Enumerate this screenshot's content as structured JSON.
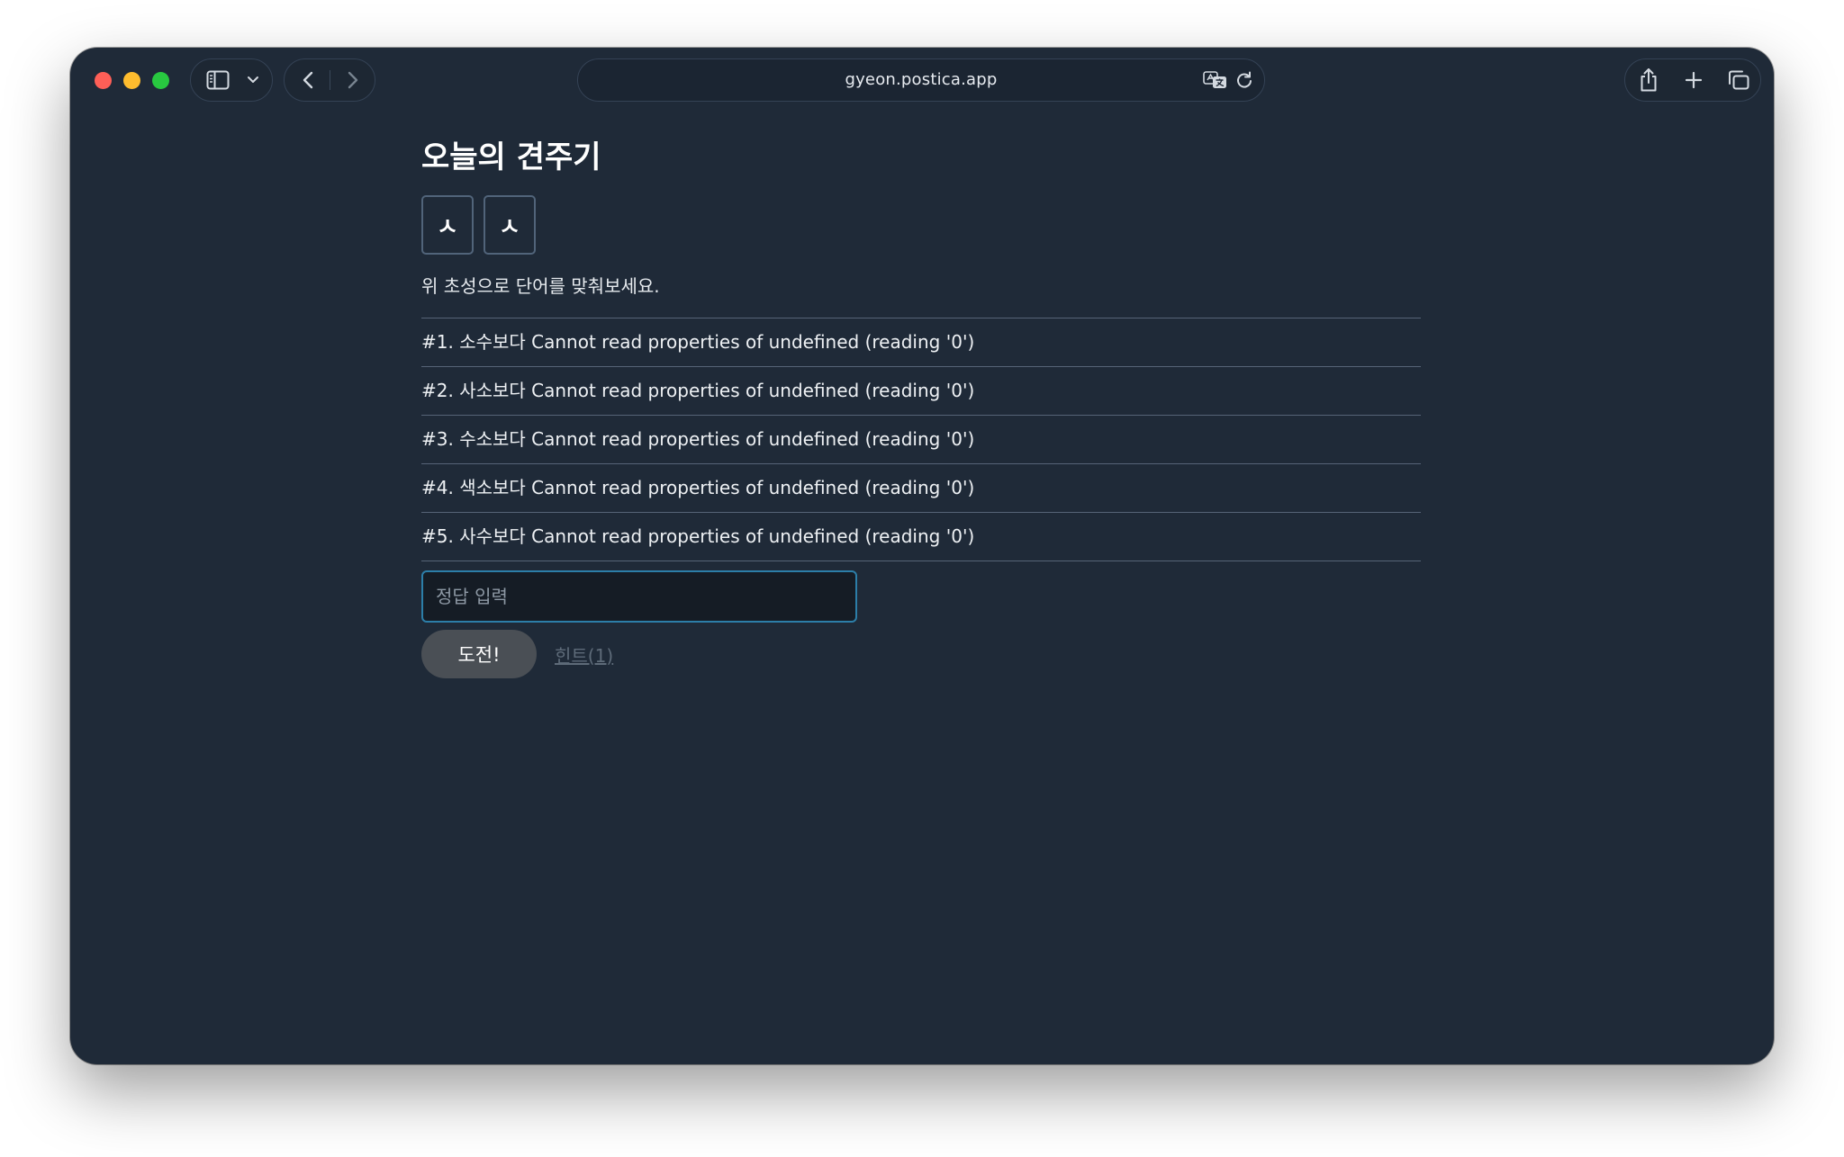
{
  "browser": {
    "url": "gyeon.postica.app"
  },
  "page": {
    "title": "오늘의 견주기",
    "tiles": [
      "ㅅ",
      "ㅅ"
    ],
    "instruction": "위 초성으로 단어를 맞춰보세요.",
    "results": [
      "#1. 소수보다 Cannot read properties of undefined (reading '0')",
      "#2. 사소보다 Cannot read properties of undefined (reading '0')",
      "#3. 수소보다 Cannot read properties of undefined (reading '0')",
      "#4. 색소보다 Cannot read properties of undefined (reading '0')",
      "#5. 사수보다 Cannot read properties of undefined (reading '0')"
    ],
    "answer_input": {
      "placeholder": "정답 입력",
      "value": ""
    },
    "challenge_label": "도전!",
    "hint_label": "힌트(1)"
  },
  "colors": {
    "background": "#1f2a38",
    "input_focus_border": "#2c7ea8",
    "button_bg": "#4a4f55"
  }
}
